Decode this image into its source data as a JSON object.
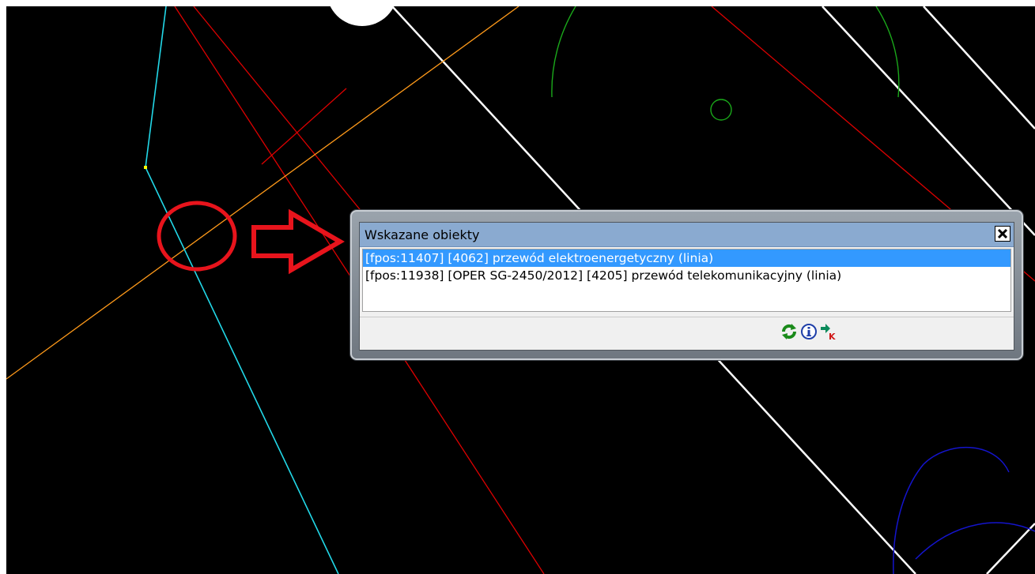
{
  "dialog": {
    "title": "Wskazane obiekty",
    "items": [
      {
        "text": "[fpos:11407] [4062] przewód elektroenergetyczny (linia)",
        "selected": true
      },
      {
        "text": "[fpos:11938] [OPER SG-2450/2012] [4205] przewód telekomunikacyjny (linia)",
        "selected": false
      }
    ],
    "toolbar": [
      {
        "icon": "refresh-icon",
        "color": "#1a8a1a"
      },
      {
        "icon": "info-icon",
        "color": "#1e3ea8"
      },
      {
        "icon": "arrow-k-icon",
        "color": "#0a8a5a"
      }
    ]
  },
  "colors": {
    "canvas_background": "#000000",
    "selection": "#3399ff",
    "annotation": "#e8141c",
    "titlebar": "#8aaad0"
  }
}
